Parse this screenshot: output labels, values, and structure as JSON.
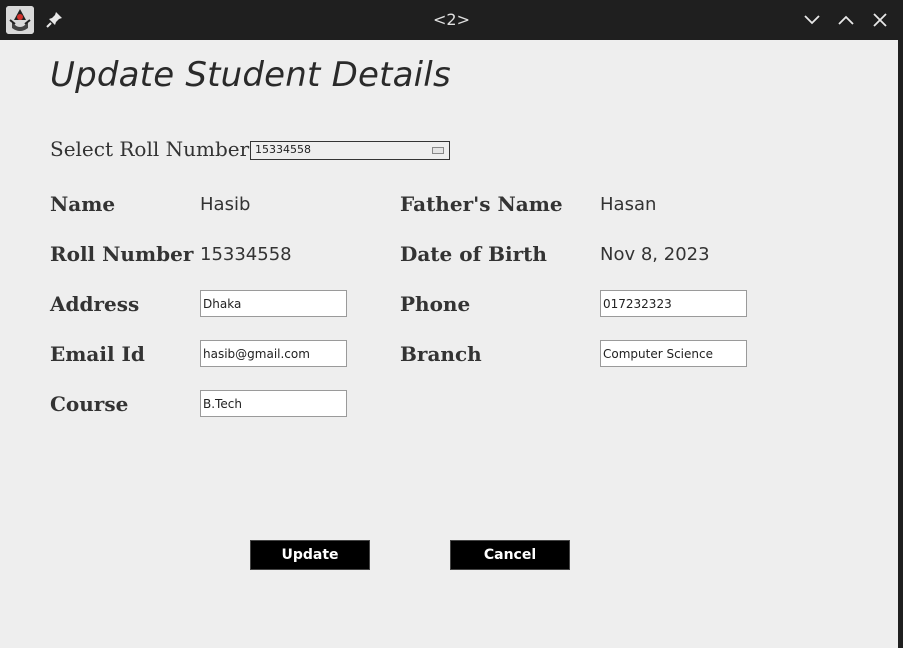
{
  "window": {
    "title": "<2>",
    "icons": {
      "app": "java-duke-icon",
      "pin": "pin-icon",
      "minimize": "chevron-down-icon",
      "maximize": "chevron-up-icon",
      "close": "close-icon"
    }
  },
  "form": {
    "heading": "Update Student Details",
    "select_label": "Select Roll Number",
    "selected_roll": "15334558",
    "labels": {
      "name": "Name",
      "fathers_name": "Father's Name",
      "roll_number": "Roll Number",
      "dob": "Date of Birth",
      "address": "Address",
      "phone": "Phone",
      "email": "Email Id",
      "branch": "Branch",
      "course": "Course"
    },
    "values": {
      "name": "Hasib",
      "fathers_name": "Hasan",
      "roll_number": "15334558",
      "dob": "Nov 8, 2023"
    },
    "fields": {
      "address": "Dhaka",
      "phone": "017232323",
      "email": "hasib@gmail.com",
      "branch": "Computer Science",
      "course": "B.Tech"
    },
    "buttons": {
      "update": "Update",
      "cancel": "Cancel"
    }
  },
  "colors": {
    "titlebar": "#1f1f1f",
    "background": "#eeeeee",
    "button": "#000000",
    "button_text": "#ffffff"
  }
}
